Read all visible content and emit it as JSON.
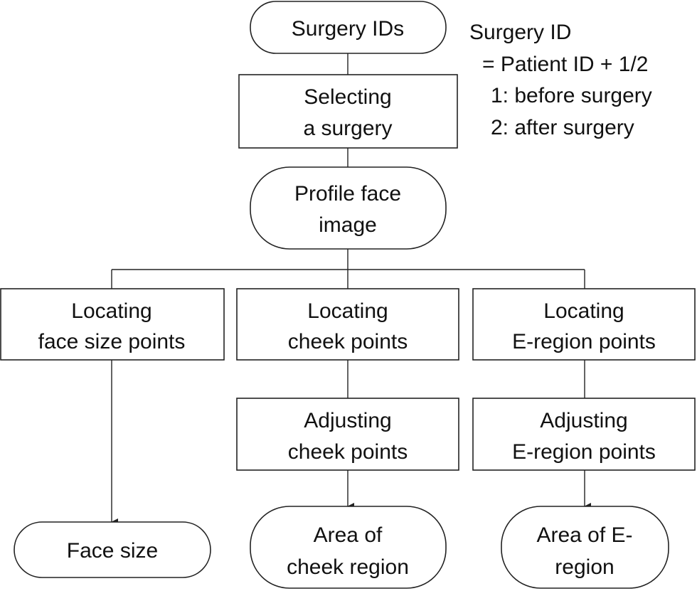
{
  "nodes": {
    "surgery_ids": {
      "lines": [
        "Surgery IDs"
      ]
    },
    "selecting_surgery": {
      "lines": [
        "Selecting",
        "a surgery"
      ]
    },
    "profile_face_image": {
      "lines": [
        "Profile face",
        "image"
      ]
    },
    "locating_face_size": {
      "lines": [
        "Locating",
        "face size points"
      ]
    },
    "locating_cheek": {
      "lines": [
        "Locating",
        "cheek points"
      ]
    },
    "locating_eregion": {
      "lines": [
        "Locating",
        "E-region points"
      ]
    },
    "adjusting_cheek": {
      "lines": [
        "Adjusting",
        "cheek points"
      ]
    },
    "adjusting_eregion": {
      "lines": [
        "Adjusting",
        "E-region points"
      ]
    },
    "face_size": {
      "lines": [
        "Face size"
      ]
    },
    "area_cheek": {
      "lines": [
        "Area of",
        "cheek region"
      ]
    },
    "area_eregion": {
      "lines": [
        "Area of E-",
        "region"
      ]
    }
  },
  "annotation": {
    "lines": [
      "Surgery ID",
      "= Patient ID + 1/2",
      "1: before surgery",
      "2: after surgery"
    ]
  }
}
